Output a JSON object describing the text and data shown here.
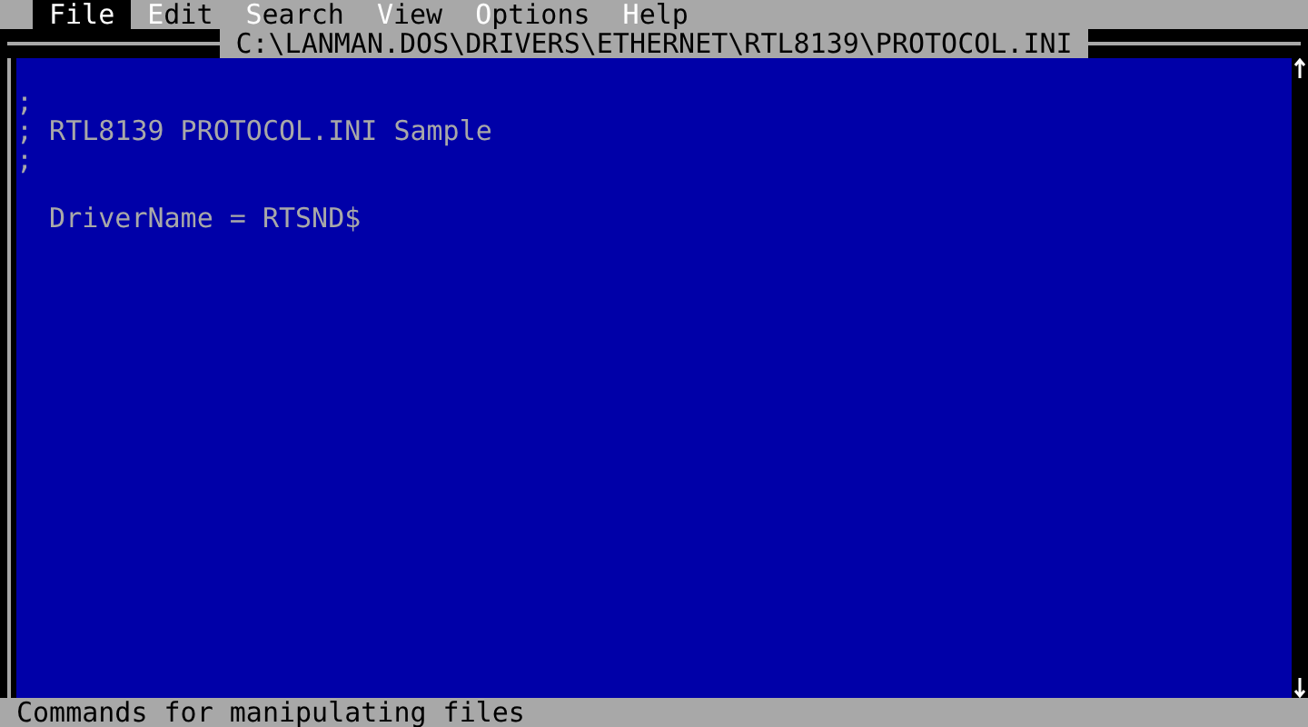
{
  "menu": [
    {
      "label": "File",
      "selected": true
    },
    {
      "label": "Edit",
      "selected": false
    },
    {
      "label": "Search",
      "selected": false
    },
    {
      "label": "View",
      "selected": false
    },
    {
      "label": "Options",
      "selected": false
    },
    {
      "label": "Help",
      "selected": false
    }
  ],
  "window": {
    "title": "C:\\LANMAN.DOS\\DRIVERS\\ETHERNET\\RTL8139\\PROTOCOL.INI"
  },
  "editor": {
    "paragraphs": [
      {
        "lines": [
          ";",
          "; RTL8139 PROTOCOL.INI Sample",
          ";"
        ]
      },
      {
        "lines": [
          "  DriverName = RTSND$"
        ]
      }
    ]
  },
  "status_bar": "Commands for manipulating files"
}
